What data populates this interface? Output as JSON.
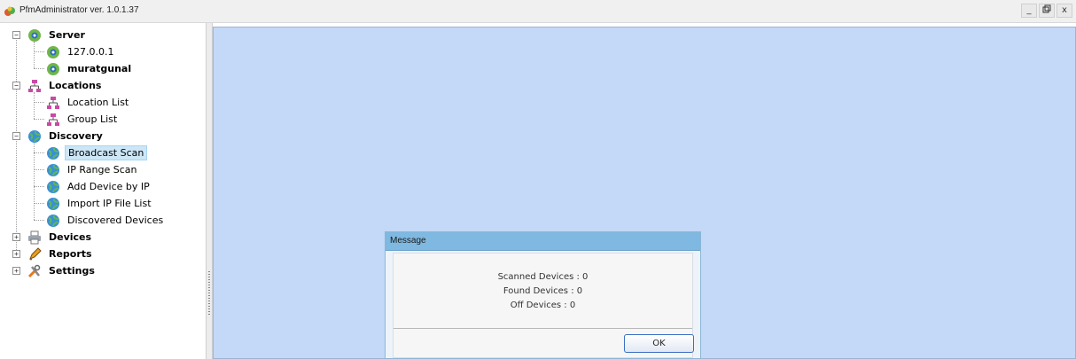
{
  "window": {
    "title": "PfmAdministrator ver. 1.0.1.37",
    "minimize": "_",
    "restore": "̳",
    "close": "x"
  },
  "tree": {
    "server": {
      "label": "Server",
      "children": [
        "127.0.0.1",
        "muratgunal"
      ]
    },
    "locations": {
      "label": "Locations",
      "children": [
        "Location List",
        "Group List"
      ]
    },
    "discovery": {
      "label": "Discovery",
      "children": [
        "Broadcast Scan",
        "IP Range Scan",
        "Add Device by IP",
        "Import IP File List",
        "Discovered Devices"
      ],
      "selected": "Broadcast Scan"
    },
    "devices": {
      "label": "Devices"
    },
    "reports": {
      "label": "Reports"
    },
    "settings": {
      "label": "Settings"
    }
  },
  "dialog": {
    "title": "Message",
    "lines": [
      "Scanned Devices : 0",
      "Found Devices : 0",
      "Off Devices : 0"
    ],
    "ok_label": "OK"
  },
  "colors": {
    "workspace": "#c3d9f7",
    "dialog_header": "#7fb8e0",
    "selection": "#cde6f7"
  }
}
